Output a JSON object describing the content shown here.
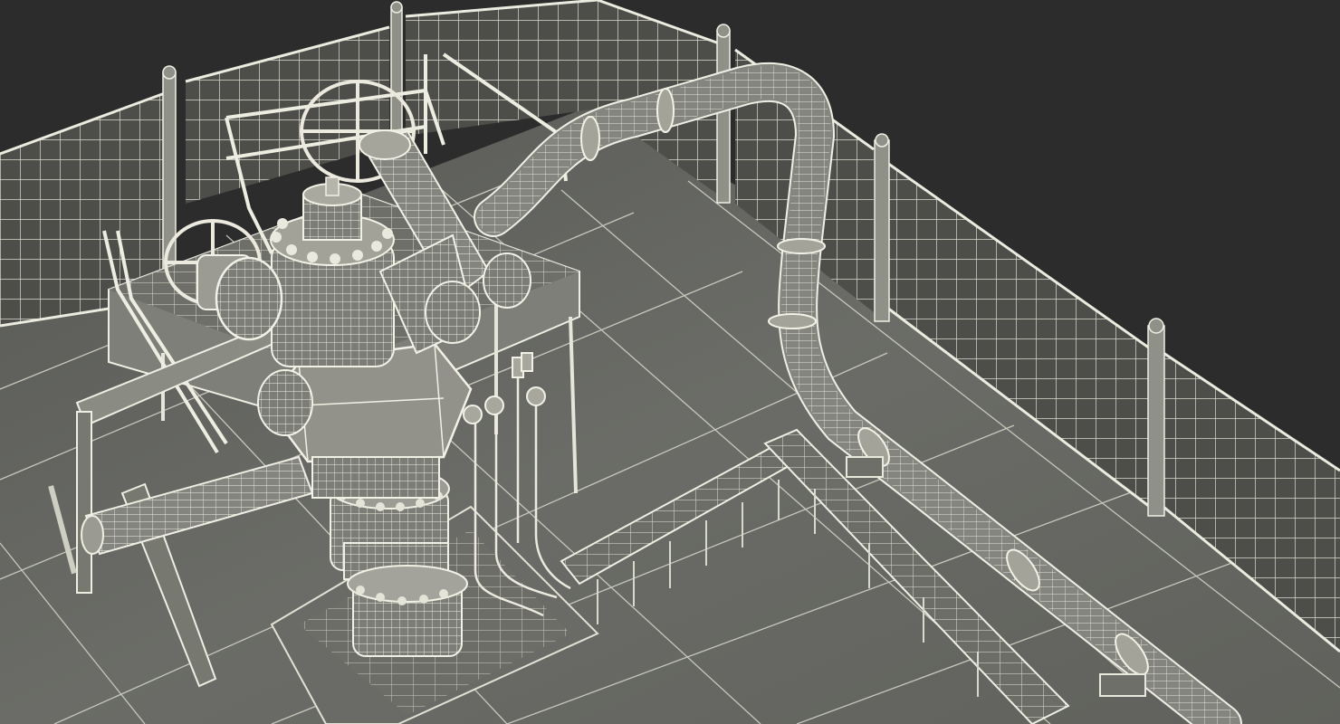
{
  "scene": {
    "subject": "wireframe-oil-wellhead-platform",
    "render_style": "wireframe-over-shaded",
    "colors": {
      "background": "#2b2c2b",
      "floor": "#666763",
      "floor_light": "#7a7b76",
      "wire": "#e9e8dc",
      "wire_dim": "#b9b8ad",
      "metal": "#8e8e86",
      "metal_dark": "#55564f"
    }
  }
}
